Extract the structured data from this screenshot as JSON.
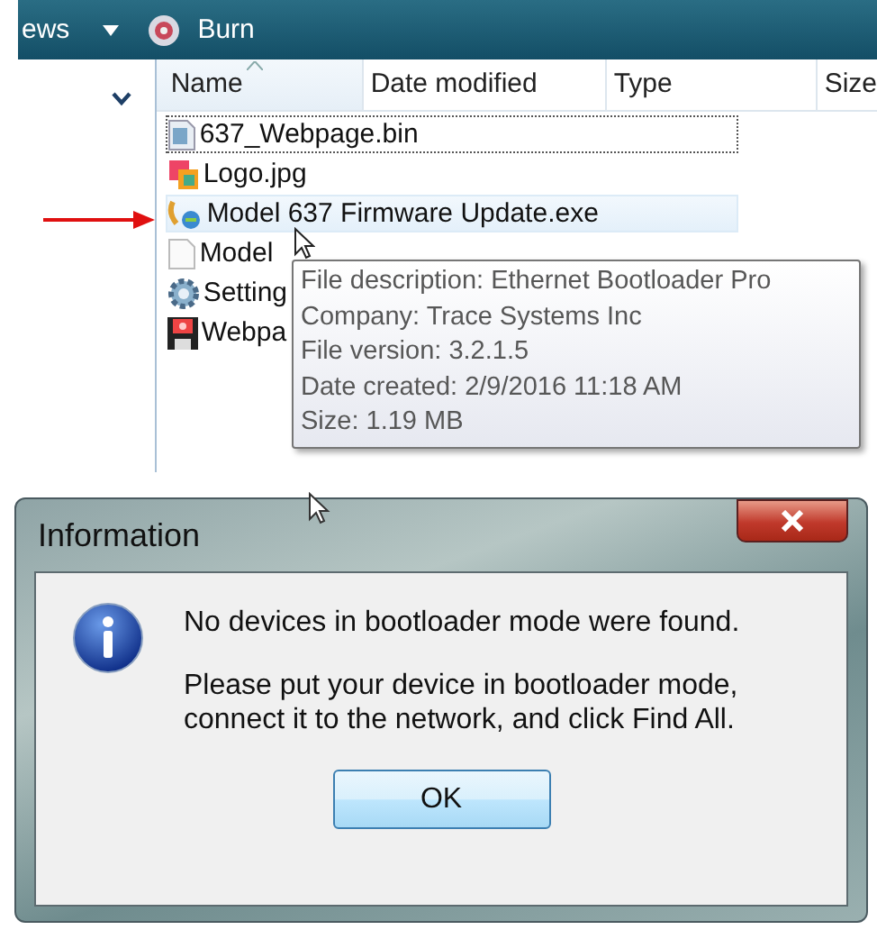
{
  "explorer": {
    "toolbar": [
      {
        "kind": "dropdown",
        "label": "ews"
      },
      {
        "kind": "burn",
        "label": "Burn"
      }
    ],
    "columns": [
      "Name",
      "Date modified",
      "Type",
      "Size"
    ],
    "files": [
      {
        "name": "637_Webpage.bin",
        "kind": "bin",
        "focused": true,
        "hovered": false
      },
      {
        "name": "Logo.jpg",
        "kind": "image",
        "focused": false,
        "hovered": false
      },
      {
        "name": "Model 637 Firmware Update.exe",
        "kind": "exe",
        "focused": false,
        "hovered": true
      },
      {
        "name": "Model",
        "kind": "doc",
        "focused": false,
        "hovered": false
      },
      {
        "name": "Setting",
        "kind": "settings",
        "focused": false,
        "hovered": false
      },
      {
        "name": "Webpa",
        "kind": "disk",
        "focused": false,
        "hovered": false
      }
    ],
    "tooltip": [
      "File description: Ethernet Bootloader Pro",
      "Company: Trace Systems Inc",
      "File version: 3.2.1.5",
      "Date created: 2/9/2016 11:18 AM",
      "Size: 1.19 MB"
    ]
  },
  "dialog": {
    "title": "Information",
    "messages": [
      "No devices in bootloader mode were found.",
      "Please put your device in bootloader mode, connect it to the network, and click Find All."
    ],
    "button": "OK"
  }
}
